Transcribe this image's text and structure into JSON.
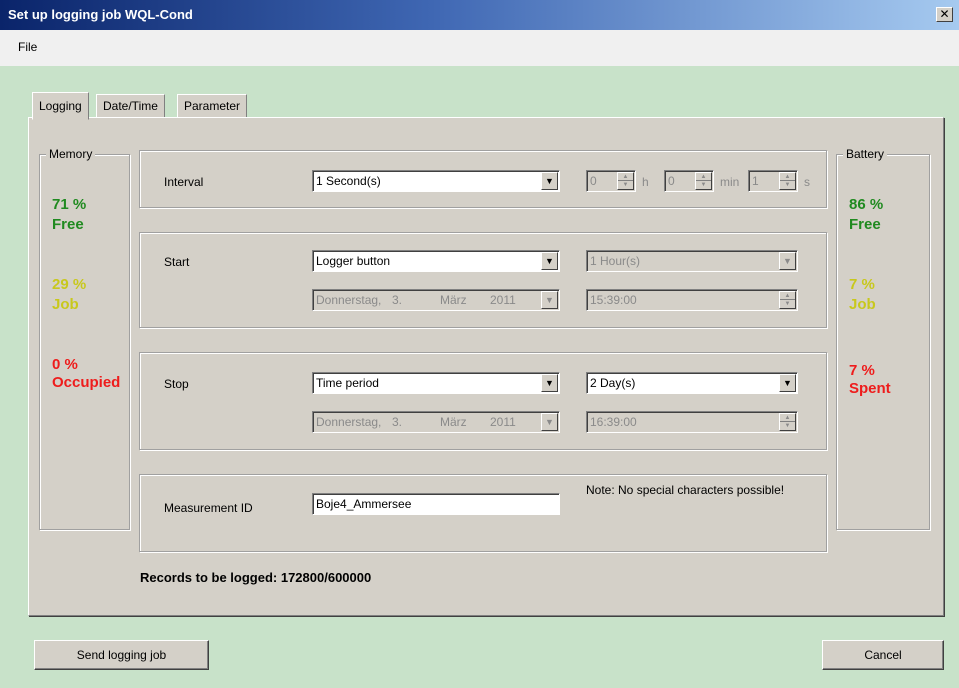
{
  "window": {
    "title": "Set up logging job WQL-Cond",
    "close_glyph": "✕"
  },
  "menu": {
    "items": [
      "File"
    ]
  },
  "tabs": [
    {
      "label": "Logging",
      "active": true
    },
    {
      "label": "Date/Time",
      "active": false
    },
    {
      "label": "Parameter",
      "active": false
    }
  ],
  "memory": {
    "title": "Memory",
    "free_pct": "71 %",
    "free_label": "Free",
    "job_pct": "29 %",
    "job_label": "Job",
    "occupied_pct": "0 %",
    "occupied_label": "Occupied"
  },
  "battery": {
    "title": "Battery",
    "free_pct": "86 %",
    "free_label": "Free",
    "job_pct": "7 %",
    "job_label": "Job",
    "spent_pct": "7 %",
    "spent_label": "Spent"
  },
  "interval": {
    "label": "Interval",
    "selected": "1 Second(s)",
    "hours": "0",
    "hours_unit": "h",
    "minutes": "0",
    "minutes_unit": "min",
    "seconds": "1",
    "seconds_unit": "s"
  },
  "start": {
    "label": "Start",
    "mode": "Logger button",
    "delay": "1 Hour(s)",
    "date": {
      "weekday": "Donnerstag,",
      "day": "3.",
      "month": "März",
      "year": "2011"
    },
    "time": "15:39:00"
  },
  "stop": {
    "label": "Stop",
    "mode": "Time period",
    "period": "2 Day(s)",
    "date": {
      "weekday": "Donnerstag,",
      "day": "3.",
      "month": "März",
      "year": "2011"
    },
    "time": "16:39:00"
  },
  "measurement": {
    "label": "Measurement ID",
    "value": "Boje4_Ammersee",
    "note": "Note: No special characters possible!"
  },
  "records": "Records to be logged: 172800/600000",
  "buttons": {
    "send": "Send logging job",
    "cancel": "Cancel"
  },
  "colors": {
    "free": "#208a20",
    "job": "#c8c81c",
    "spent": "#ee1c1c",
    "background": "#c8e2c9"
  },
  "icons": {
    "dropdown": "▼",
    "spin_up": "▲",
    "spin_down": "▼"
  }
}
